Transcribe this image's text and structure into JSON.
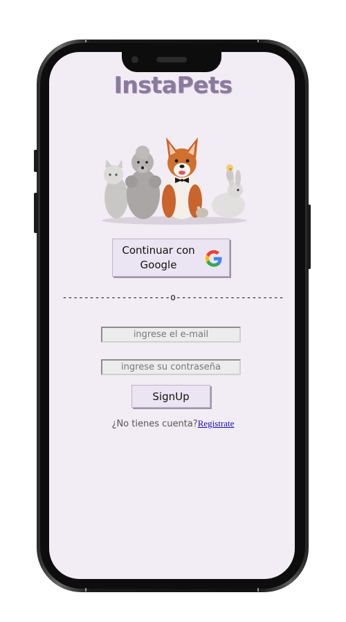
{
  "app": {
    "logo_text": "InstaPets"
  },
  "hero": {
    "image_name": "pets-group-image"
  },
  "google_button": {
    "label": "Continuar con Google",
    "icon": "google-icon",
    "colors": {
      "blue": "#4285F4",
      "red": "#EA4335",
      "yellow": "#FBBC05",
      "green": "#34A853"
    }
  },
  "divider": {
    "text": "--------------------o--------------------"
  },
  "form": {
    "email_placeholder": "ingrese el e-mail",
    "password_placeholder": "ingrese su contraseña",
    "signup_label": "SignUp"
  },
  "register": {
    "prompt": "¿No tienes cuenta?",
    "link_label": "Registrate"
  },
  "colors": {
    "screen_bg": "#f2ecf4",
    "logo": "#8a7a9e",
    "button_bg": "#ebe4f2",
    "link": "#1a0dab"
  }
}
